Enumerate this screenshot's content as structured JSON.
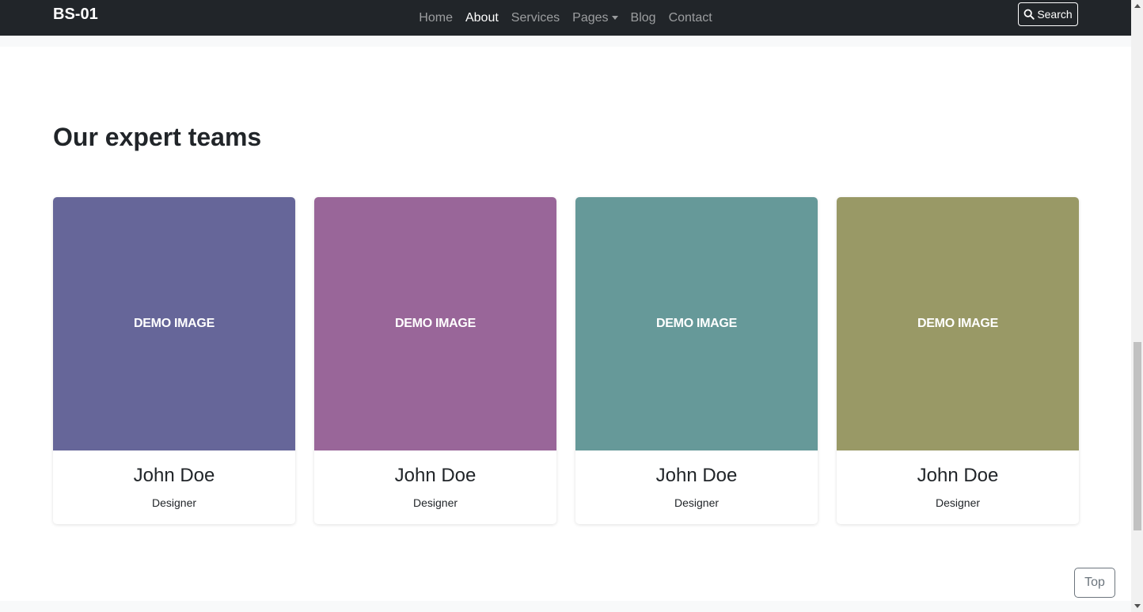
{
  "navbar": {
    "brand": "BS-01",
    "links": [
      {
        "label": "Home",
        "active": false
      },
      {
        "label": "About",
        "active": true
      },
      {
        "label": "Services",
        "active": false
      },
      {
        "label": "Pages",
        "active": false,
        "dropdown": true
      },
      {
        "label": "Blog",
        "active": false
      },
      {
        "label": "Contact",
        "active": false
      }
    ],
    "search_label": "Search",
    "search_icon": "magnifier-icon"
  },
  "section": {
    "title": "Our expert teams"
  },
  "team": [
    {
      "image_text": "DEMO IMAGE",
      "name": "John Doe",
      "role": "Designer",
      "color": "#666699"
    },
    {
      "image_text": "DEMO IMAGE",
      "name": "John Doe",
      "role": "Designer",
      "color": "#996699"
    },
    {
      "image_text": "DEMO IMAGE",
      "name": "John Doe",
      "role": "Designer",
      "color": "#669999"
    },
    {
      "image_text": "DEMO IMAGE",
      "name": "John Doe",
      "role": "Designer",
      "color": "#999966"
    }
  ],
  "top_button": {
    "label": "Top"
  },
  "colors": {
    "navbar_bg": "#212529",
    "band_bg": "#f8f9fa"
  }
}
